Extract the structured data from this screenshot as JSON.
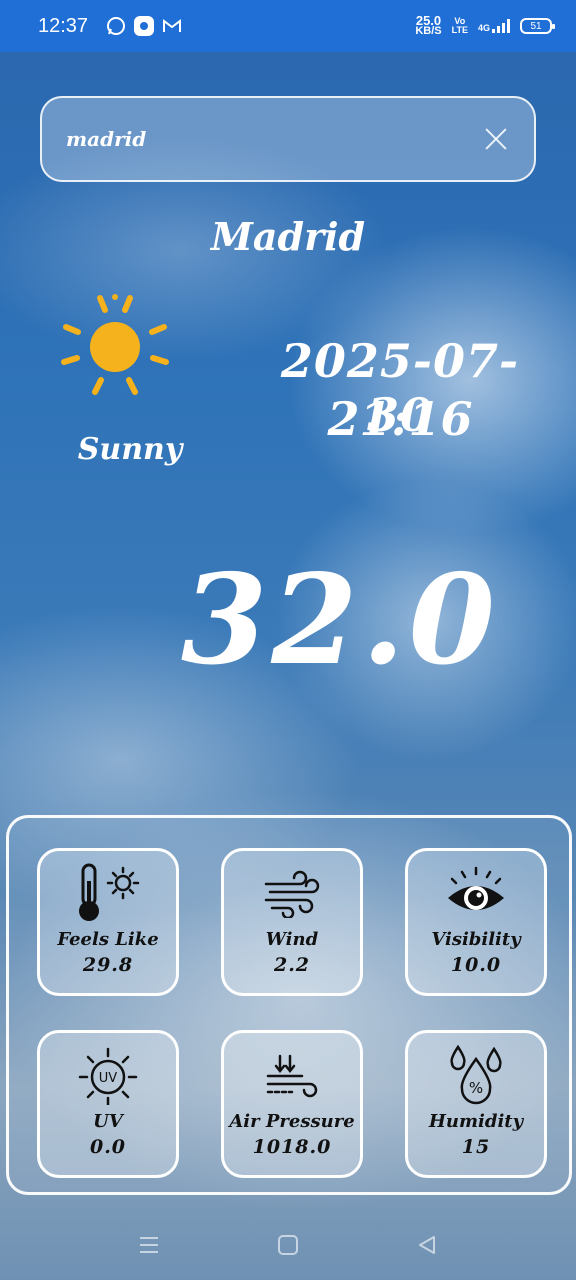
{
  "status_bar": {
    "time": "12:37",
    "net_speed_value": "25.0",
    "net_speed_unit": "KB/S",
    "volte_top": "Vo",
    "volte_bottom": "LTE",
    "network": "4G",
    "battery": "51"
  },
  "search": {
    "value": "madrid",
    "clear_icon": "close-icon"
  },
  "weather": {
    "city": "Madrid",
    "condition": "Sunny",
    "condition_icon": "sun-icon",
    "date": "2025-07-30",
    "time": "21:16",
    "temperature": "32.0"
  },
  "metrics": [
    {
      "label": "Feels Like",
      "value": "29.8",
      "icon": "thermometer-sun-icon"
    },
    {
      "label": "Wind",
      "value": "2.2",
      "icon": "wind-icon"
    },
    {
      "label": "Visibility",
      "value": "10.0",
      "icon": "eye-icon"
    },
    {
      "label": "UV",
      "value": "0.0",
      "icon": "uv-icon"
    },
    {
      "label": "Air Pressure",
      "value": "1018.0",
      "icon": "air-pressure-icon"
    },
    {
      "label": "Humidity",
      "value": "15",
      "icon": "humidity-icon"
    }
  ],
  "colors": {
    "status_bar": "#1f6fd6",
    "sun": "#f5b21c",
    "card_text": "#111111"
  }
}
